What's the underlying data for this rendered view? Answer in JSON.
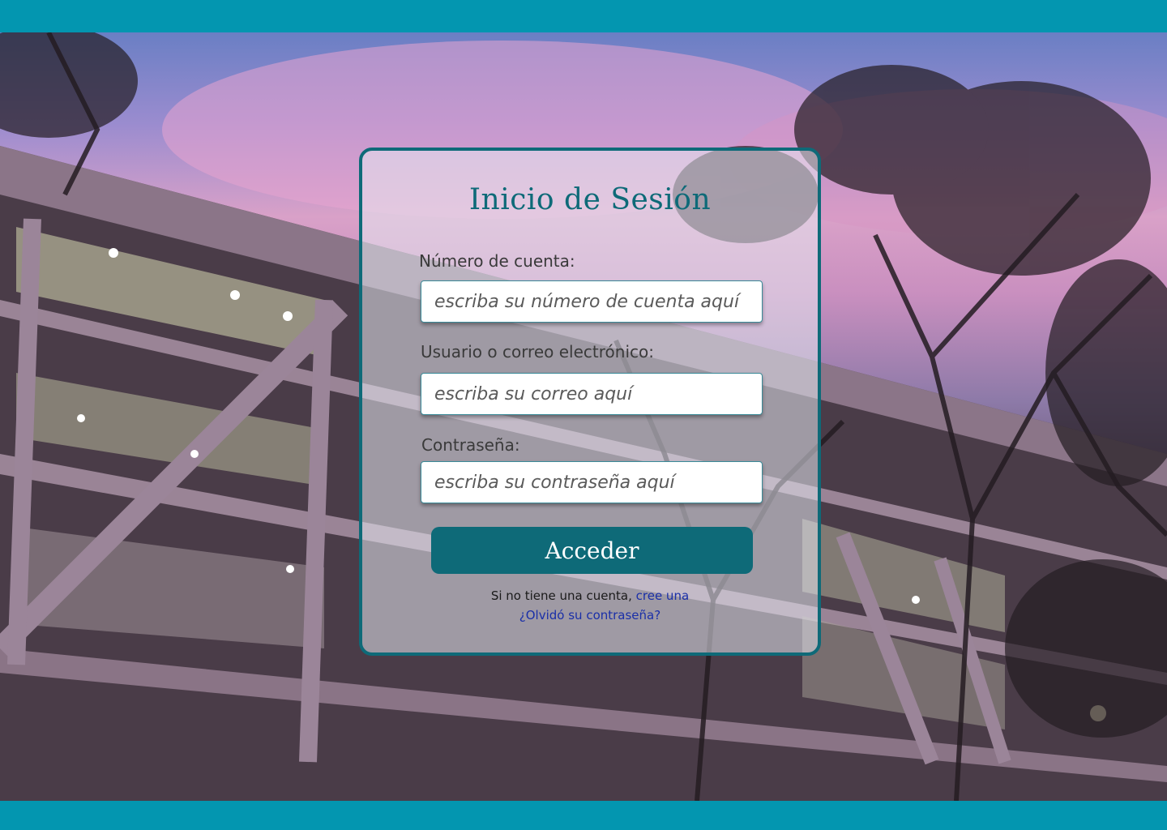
{
  "login": {
    "title": "Inicio de Sesión",
    "account_label": "Número de cuenta:",
    "account_placeholder": "escriba su número de cuenta aquí",
    "email_label": "Usuario o correo electrónico:",
    "email_placeholder": "escriba su correo aquí",
    "password_label": "Contraseña:",
    "password_placeholder": "escriba su contraseña aquí",
    "submit_label": "Acceder",
    "signup_prompt": "Si no tiene una cuenta,",
    "signup_link": "cree una",
    "forgot_link": "¿Olvidó su contraseña?"
  },
  "colors": {
    "header_bar": "#0396b0",
    "accent": "#0e6a78",
    "link": "#1a2fa8"
  }
}
